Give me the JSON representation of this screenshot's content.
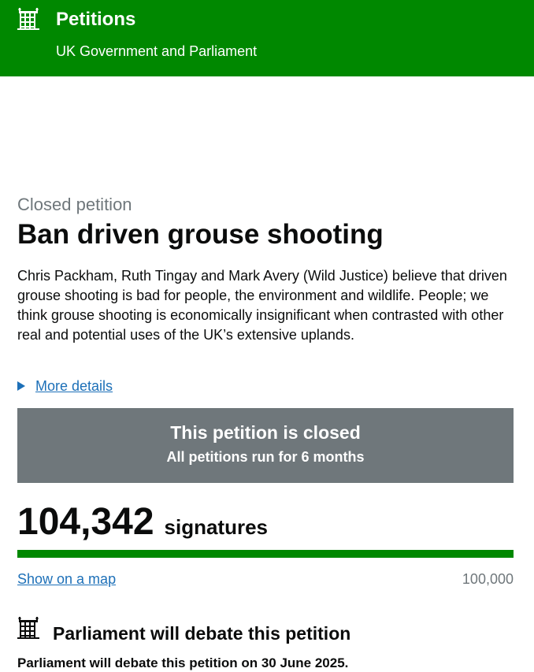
{
  "header": {
    "title": "Petitions",
    "subtitle": "UK Government and Parliament",
    "logo_icon": "portcullis-icon",
    "background_color": "#008800"
  },
  "petition": {
    "status_caption": "Closed petition",
    "title": "Ban driven grouse shooting",
    "summary": "Chris Packham, Ruth Tingay and Mark Avery (Wild Justice) believe that driven grouse shooting is bad for people, the environment and wildlife. People; we think grouse shooting is economically insignificant when contrasted with other real and potential uses of the UK’s extensive uplands.",
    "more_details_label": "More details"
  },
  "closed_banner": {
    "title": "This petition is closed",
    "subtitle": "All petitions run for 6 months",
    "background_color": "#6f777b"
  },
  "signatures": {
    "count": "104,342",
    "label": "signatures",
    "threshold": "100,000",
    "progress_fraction": 1.0,
    "show_map_label": "Show on a map"
  },
  "debate": {
    "icon": "portcullis-icon",
    "heading": "Parliament will debate this petition",
    "text": "Parliament will debate this petition on 30 June 2025."
  }
}
